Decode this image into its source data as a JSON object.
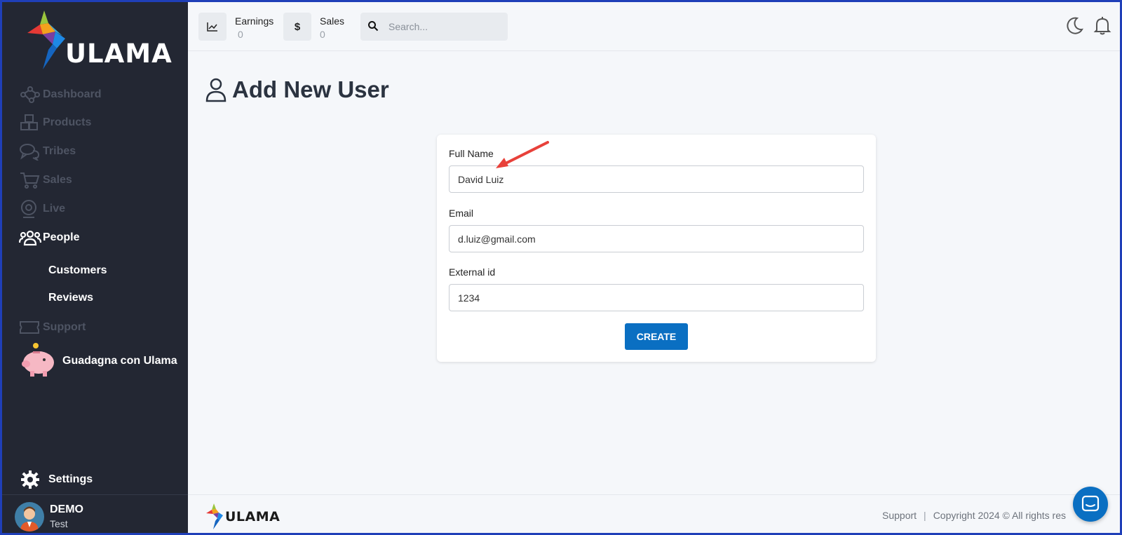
{
  "sidebar": {
    "logo_text": "ULAMA",
    "items": [
      {
        "label": "Dashboard",
        "icon": "network-icon"
      },
      {
        "label": "Products",
        "icon": "boxes-icon"
      },
      {
        "label": "Tribes",
        "icon": "chat-bubbles-icon"
      },
      {
        "label": "Sales",
        "icon": "cart-icon"
      },
      {
        "label": "Live",
        "icon": "webcam-icon"
      },
      {
        "label": "People",
        "icon": "people-icon"
      },
      {
        "label": "Support",
        "icon": "ticket-icon"
      }
    ],
    "sub_items": [
      {
        "label": "Customers"
      },
      {
        "label": "Reviews"
      }
    ],
    "promo_label": "Guadagna con Ulama",
    "settings_label": "Settings",
    "user": {
      "name": "DEMO",
      "subtitle": "Test"
    }
  },
  "topbar": {
    "earnings_label": "Earnings",
    "earnings_value": "0",
    "sales_label": "Sales",
    "sales_value": "0",
    "sales_icon_glyph": "$",
    "search_placeholder": "Search..."
  },
  "main": {
    "title": "Add New User",
    "form": {
      "full_name_label": "Full Name",
      "full_name_value": "David Luiz",
      "email_label": "Email",
      "email_value": "d.luiz@gmail.com",
      "external_id_label": "External id",
      "external_id_value": "1234",
      "create_label": "CREATE"
    }
  },
  "footer": {
    "logo_text": "ULAMA",
    "support_label": "Support",
    "separator": "|",
    "copyright": "Copyright 2024 © All rights res"
  },
  "colors": {
    "sidebar_bg": "#232733",
    "accent": "#0a6fc2",
    "annotation_arrow": "#e8413a",
    "frame_border": "#1f3fb8"
  }
}
